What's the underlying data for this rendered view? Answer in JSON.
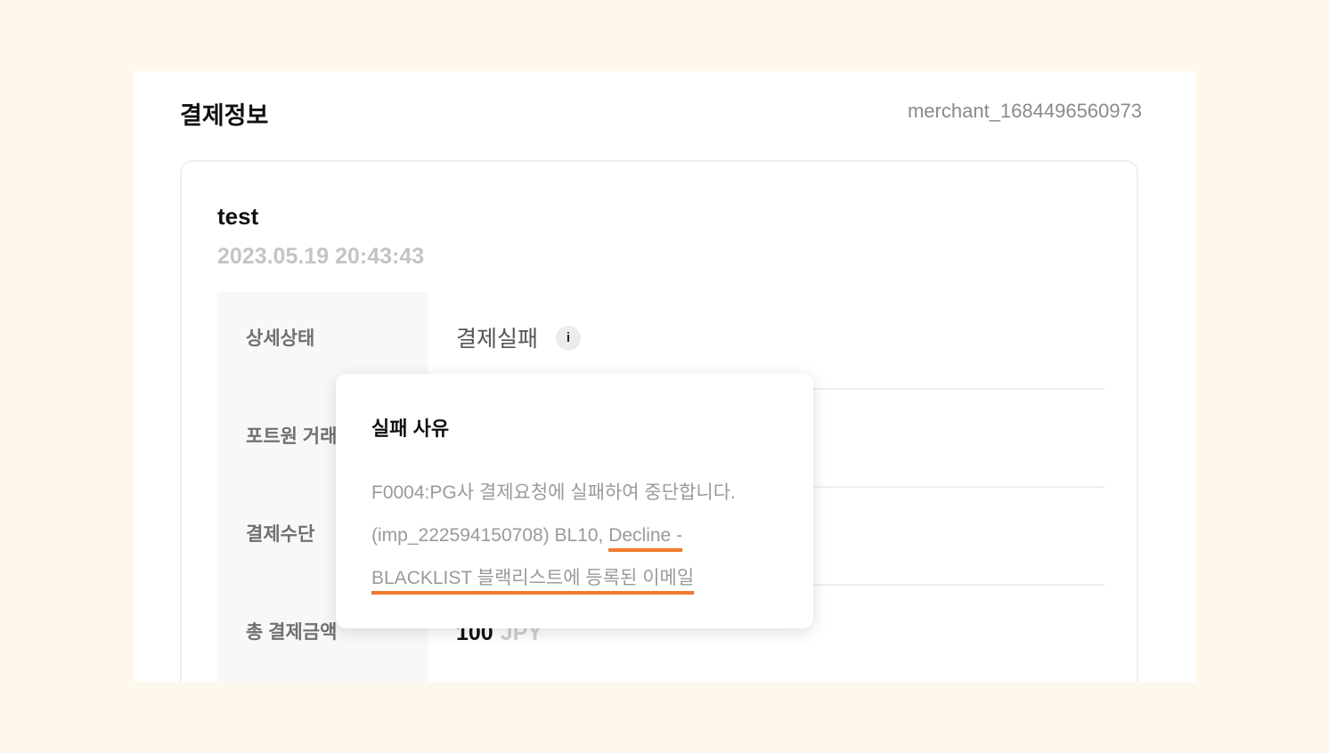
{
  "panel": {
    "title": "결제정보",
    "merchant_id": "merchant_1684496560973"
  },
  "order": {
    "name": "test",
    "date": "2023.05.19 20:43:43"
  },
  "rows": {
    "status": {
      "label": "상세상태",
      "value": "결제실패",
      "info": "i"
    },
    "tx_id": {
      "label": "포트원 거래",
      "value": ""
    },
    "method": {
      "label": "결제수단",
      "value": ""
    },
    "amount": {
      "label": "총 결제금액",
      "value": "100",
      "currency": "JPY"
    }
  },
  "tooltip": {
    "title": "실패 사유",
    "line1": "F0004:PG사 결제요청에 실패하여 중단합니다.",
    "line2_prefix": "(imp_222594150708) BL10, ",
    "highlight_1": "Decline -",
    "highlight_2": "BLACKLIST 블랙리스트에 등록된 이메일"
  },
  "colors": {
    "page_bg": "#fef8ec",
    "highlight_underline": "#f07a2a"
  }
}
